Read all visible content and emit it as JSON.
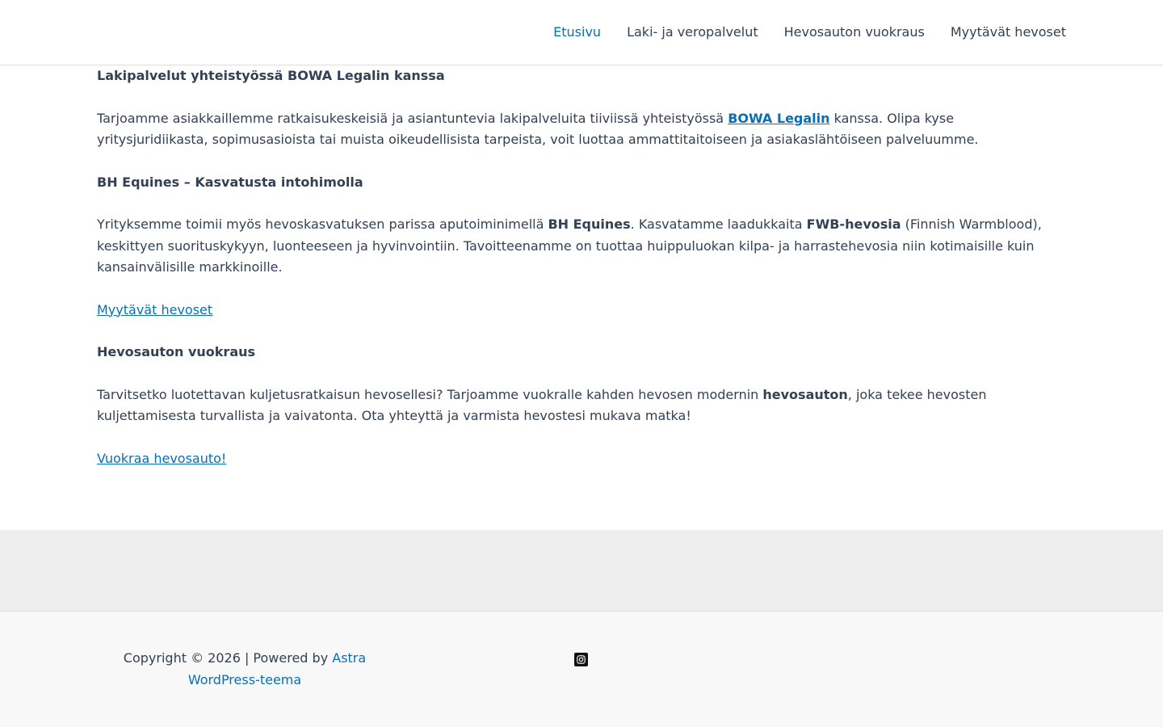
{
  "header": {
    "nav": [
      {
        "label": "Etusivu",
        "active": true
      },
      {
        "label": "Laki- ja veropalvelut",
        "active": false
      },
      {
        "label": "Hevosauton vuokraus",
        "active": false
      },
      {
        "label": "Myytävät hevoset",
        "active": false
      }
    ]
  },
  "content": {
    "legal_heading": "Lakipalvelut yhteistyössä BOWA Legalin kanssa",
    "legal_text_before": "Tarjoamme asiakkaillemme ratkaisukeskeisiä ja asiantuntevia lakipalveluita tiiviissä yhteistyössä ",
    "legal_link": "BOWA Legalin",
    "legal_text_after": " kanssa. Olipa kyse yritysjuridiikasta, sopimusasioista tai muista oikeudellisista tarpeista, voit luottaa ammattitaitoiseen ja asiakaslähtöiseen palveluumme.",
    "breeding_heading": "BH Equines – Kasvatusta intohimolla",
    "breeding_text_1": "Yrityksemme toimii myös hevoskasvatuksen parissa aputoiminimellä ",
    "breeding_bold_1": "BH Equines",
    "breeding_text_2": ". Kasvatamme laadukkaita ",
    "breeding_bold_2": "FWB-hevosia",
    "breeding_text_3": " (Finnish Warmblood), keskittyen suorituskykyyn, luonteeseen ja hyvinvointiin. Tavoitteenamme on tuottaa huippuluokan kilpa- ja harrastehevosia niin kotimaisille kuin kansainvälisille markkinoille.",
    "horses_link": "Myytävät hevoset",
    "trailer_heading": "Hevosauton vuokraus",
    "trailer_text_1": "Tarvitsetko luotettavan kuljetusratkaisun hevosellesi? Tarjoamme vuokralle kahden hevosen modernin ",
    "trailer_bold": "hevosauton",
    "trailer_text_2": ", joka tekee hevosten kuljettamisesta turvallista ja vaivatonta. Ota yhteyttä ja varmista hevostesi mukava matka!",
    "rent_link": "Vuokraa hevosauto!"
  },
  "footer": {
    "copyright_text": "Copyright © 2026 | Powered by ",
    "theme_link": "Astra WordPress-teema",
    "social_icon": "instagram-icon"
  },
  "colors": {
    "accent": "#0770b8",
    "text": "#334155",
    "footer_widget_bg": "#eeeeee",
    "footer_bg": "#f8f8f8"
  }
}
